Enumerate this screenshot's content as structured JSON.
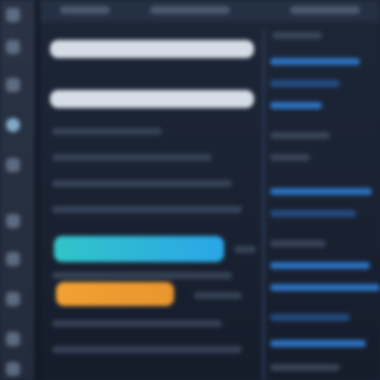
{
  "colors": {
    "rail": "#2a3446",
    "background": "#1b2434",
    "highlight_white": "#d6dde6",
    "highlight_cyan": "#31c5c8",
    "highlight_orange": "#f2a032",
    "side_accent": "#2f7fd8"
  },
  "icons": [
    "app-icon",
    "menu-icon",
    "folder-icon",
    "globe-icon",
    "settings-icon",
    "search-icon",
    "list-icon",
    "chart-icon",
    "user-icon",
    "help-icon"
  ],
  "note": ""
}
